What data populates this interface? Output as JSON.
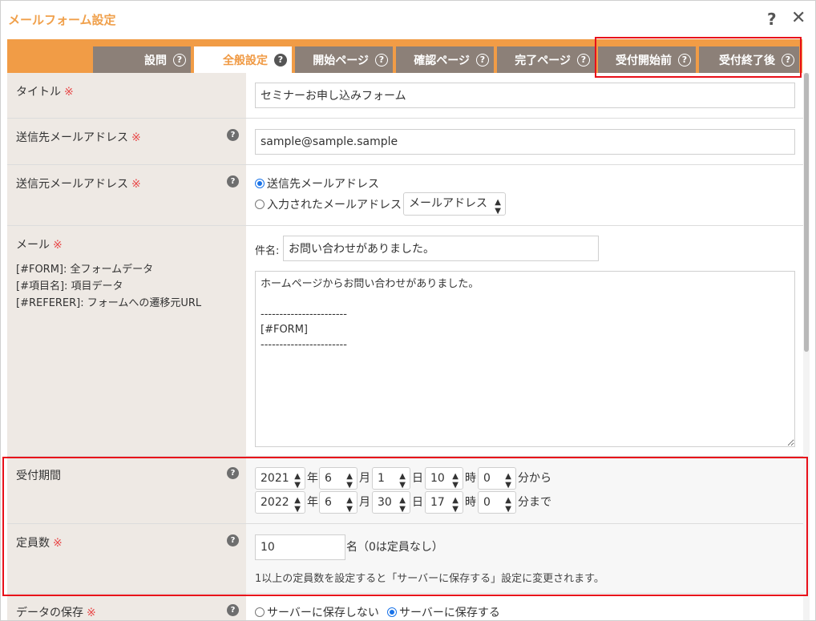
{
  "dialog": {
    "title": "メールフォーム設定",
    "help_glyph": "?",
    "close_glyph": "✕"
  },
  "tabs": [
    {
      "label": "設問",
      "active": false
    },
    {
      "label": "全般設定",
      "active": true
    },
    {
      "label": "開始ページ",
      "active": false
    },
    {
      "label": "確認ページ",
      "active": false
    },
    {
      "label": "完了ページ",
      "active": false
    },
    {
      "label": "受付開始前",
      "active": false
    },
    {
      "label": "受付終了後",
      "active": false
    }
  ],
  "tab_help_glyph": "?",
  "required_mark": "※",
  "form": {
    "title_row": {
      "label": "タイトル",
      "value": "セミナーお申し込みフォーム"
    },
    "to_row": {
      "label": "送信先メールアドレス",
      "value": "sample@sample.sample"
    },
    "from_row": {
      "label": "送信元メールアドレス",
      "option1": "送信先メールアドレス",
      "option2": "入力されたメールアドレス",
      "select_value": "メールアドレス"
    },
    "mail_row": {
      "label": "メール",
      "hint1": "[#FORM]: 全フォームデータ",
      "hint2": "[#項目名]: 項目データ",
      "hint3": "[#REFERER]: フォームへの遷移元URL",
      "subject_label": "件名:",
      "subject_value": "お問い合わせがありました。",
      "body": "ホームページからお問い合わせがありました。\n\n-----------------------\n[#FORM]\n-----------------------"
    },
    "period_row": {
      "label": "受付期間",
      "start": {
        "year": "2021",
        "month": "6",
        "day": "1",
        "hour": "10",
        "minute": "0"
      },
      "end": {
        "year": "2022",
        "month": "6",
        "day": "30",
        "hour": "17",
        "minute": "0"
      },
      "year_unit": "年",
      "month_unit": "月",
      "day_unit": "日",
      "hour_unit": "時",
      "start_suffix": "分から",
      "end_suffix": "分まで"
    },
    "capacity_row": {
      "label": "定員数",
      "value": "10",
      "unit": "名（0は定員なし）",
      "note": "1以上の定員数を設定すると「サーバーに保存する」設定に変更されます。"
    },
    "save_row": {
      "label": "データの保存",
      "option1": "サーバーに保存しない",
      "option2": "サーバーに保存する"
    }
  },
  "colors": {
    "accent": "#f19c46",
    "tab_inactive": "#8c8078",
    "label_bg": "#eee9e4",
    "highlight": "#e8101a",
    "required": "#e84a4a"
  }
}
